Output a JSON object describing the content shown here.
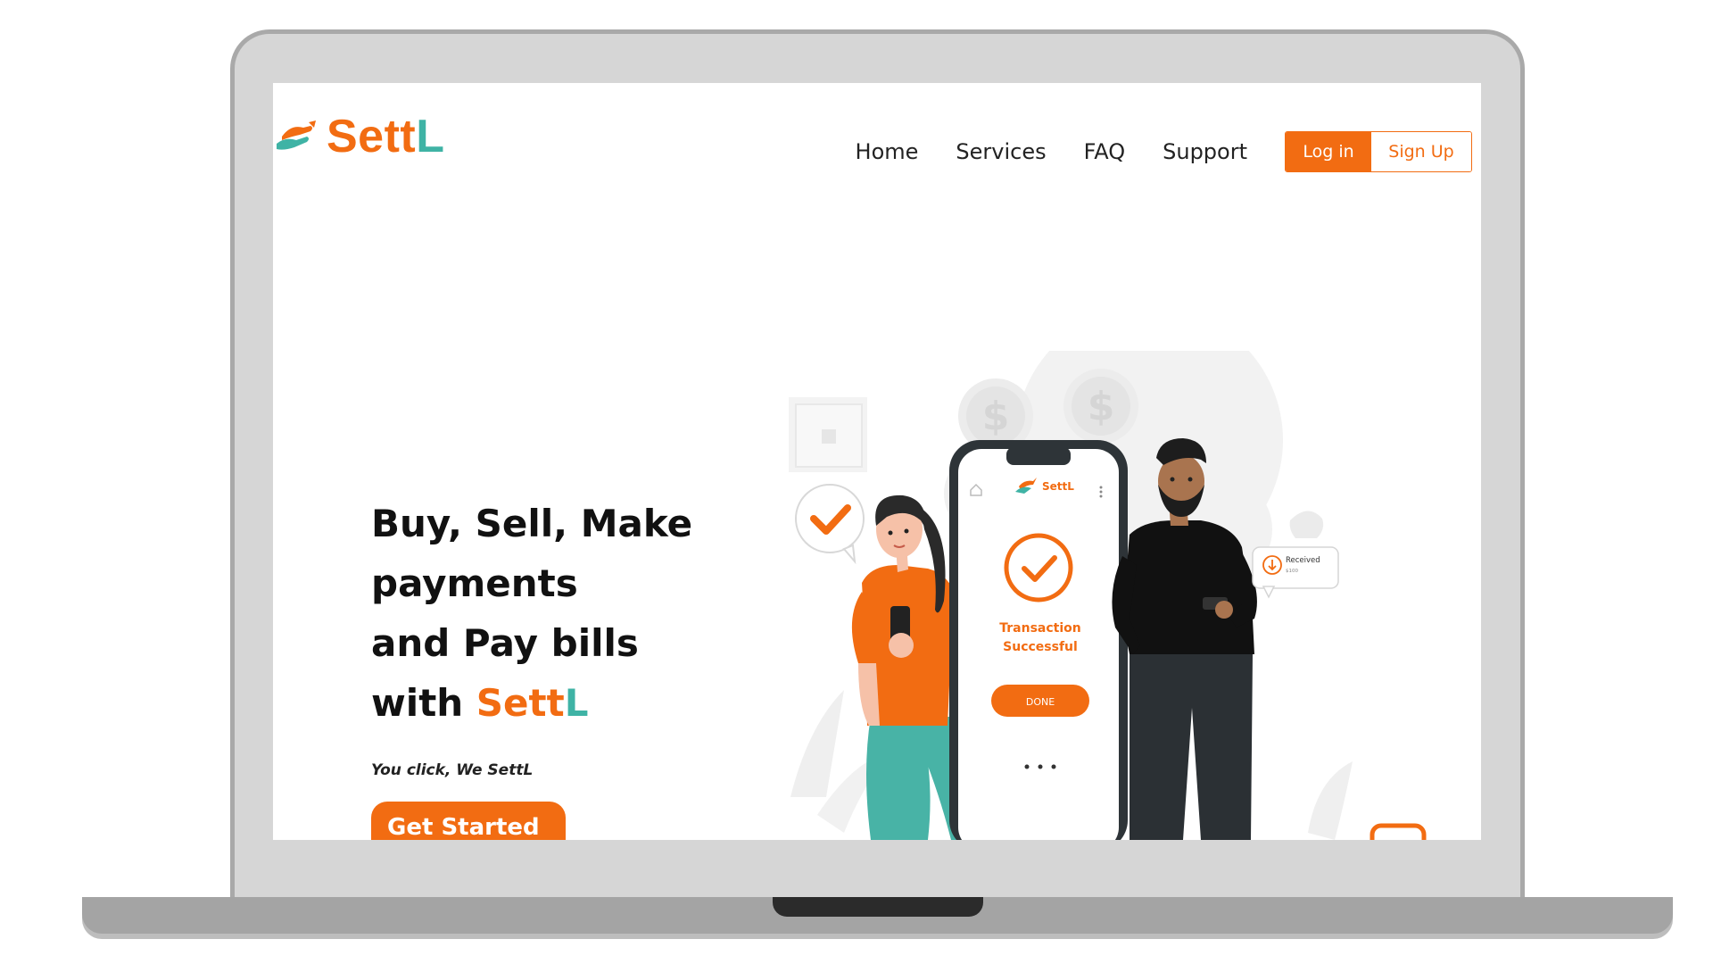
{
  "brand": {
    "name_main": "Sett",
    "name_accent": "L"
  },
  "nav": {
    "home": "Home",
    "services": "Services",
    "faq": "FAQ",
    "support": "Support"
  },
  "auth": {
    "login": "Log in",
    "signup": "Sign Up"
  },
  "hero": {
    "line1": "Buy, Sell, Make",
    "line2": "payments",
    "line3": "and Pay bills",
    "line4_prefix": "with ",
    "tagline": "You click, We SettL",
    "cta": "Get Started →"
  },
  "phone": {
    "brand": "SettL",
    "status_line1": "Transaction",
    "status_line2": "Successful",
    "done": "DONE"
  },
  "notification": {
    "title": "Received",
    "amount": "$100"
  },
  "colors": {
    "accent": "#f26c12",
    "teal": "#3fb3a5",
    "dark": "#111111"
  }
}
